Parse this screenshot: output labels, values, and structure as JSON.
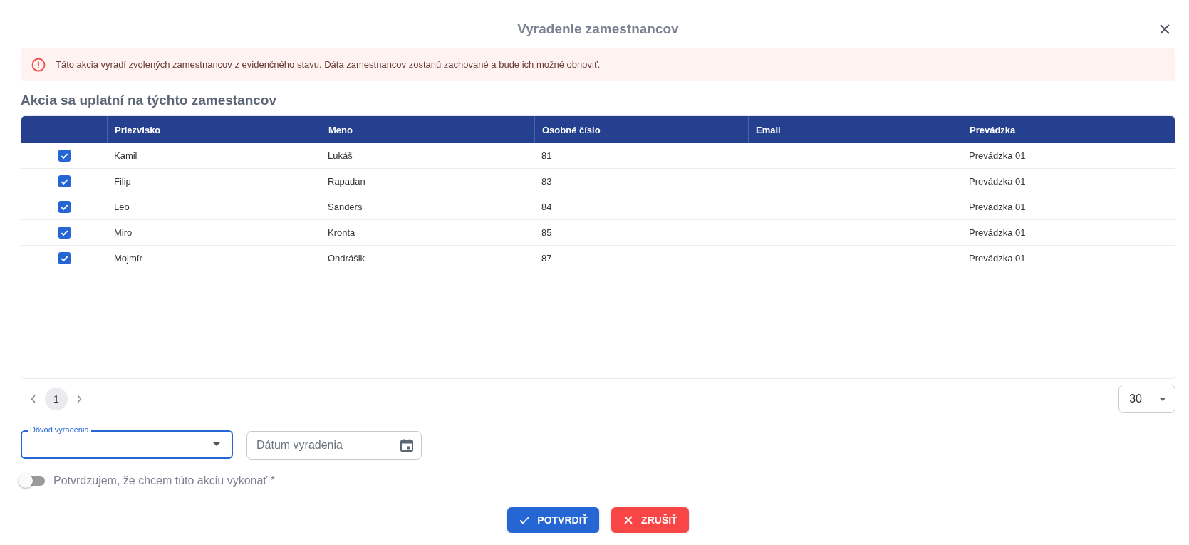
{
  "dialog": {
    "title": "Vyradenie zamestnancov"
  },
  "alert": {
    "text": "Táto akcia vyradí zvolených zamestnancov z evidenčného stavu. Dáta zamestnancov zostanú zachované a bude ich možné obnoviť."
  },
  "section_title": "Akcia sa uplatní na týchto zamestancov",
  "table": {
    "columns": [
      "Priezvisko",
      "Meno",
      "Osobné číslo",
      "Email",
      "Prevádzka"
    ],
    "rows": [
      {
        "checked": true,
        "cells": [
          "Kamil",
          "Lukáš",
          "81",
          "",
          "Prevádzka 01"
        ]
      },
      {
        "checked": true,
        "cells": [
          "Filip",
          "Rapadan",
          "83",
          "",
          "Prevádzka 01"
        ]
      },
      {
        "checked": true,
        "cells": [
          "Leo",
          "Sanders",
          "84",
          "",
          "Prevádzka 01"
        ]
      },
      {
        "checked": true,
        "cells": [
          "Miro",
          "Kronta",
          "85",
          "",
          "Prevádzka 01"
        ]
      },
      {
        "checked": true,
        "cells": [
          "Mojmír",
          "Ondrášik",
          "87",
          "",
          "Prevádzka 01"
        ]
      }
    ]
  },
  "pagination": {
    "pages": [
      {
        "label": "1",
        "selected": true
      }
    ],
    "page_size": "30"
  },
  "reason_field": {
    "label": "Dôvod vyradenia",
    "focused": true
  },
  "date_field": {
    "placeholder": "Dátum vyradenia"
  },
  "confirm_toggle": {
    "label": "Potvrdzujem, že chcem túto akciu vykonať *",
    "on": false
  },
  "buttons": [
    {
      "kind": "confirm",
      "label": "POTVRDIŤ"
    },
    {
      "kind": "cancel",
      "label": "ZRUŠIŤ"
    }
  ]
}
